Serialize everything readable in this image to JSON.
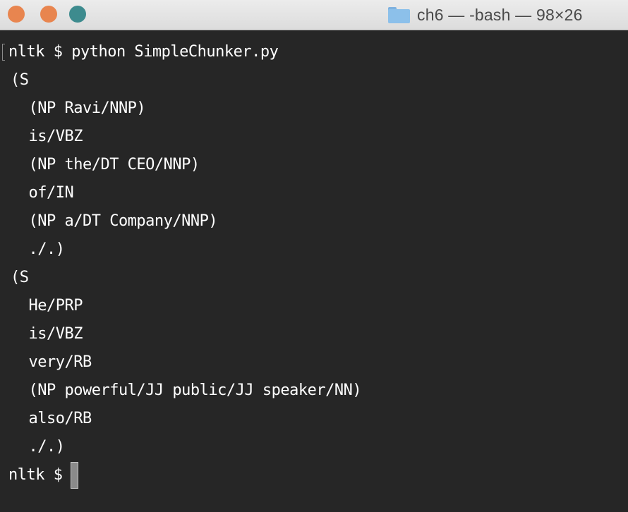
{
  "window": {
    "title": "ch6 — -bash — 98×26",
    "folder_icon": "folder-icon"
  },
  "terminal": {
    "lines": [
      "nltk $ python SimpleChunker.py",
      "(S",
      "  (NP Ravi/NNP)",
      "  is/VBZ",
      "  (NP the/DT CEO/NNP)",
      "  of/IN",
      "  (NP a/DT Company/NNP)",
      "  ./.)",
      "(S",
      "  He/PRP",
      "  is/VBZ",
      "  very/RB",
      "  (NP powerful/JJ public/JJ speaker/NN)",
      "  also/RB",
      "  ./.)"
    ],
    "prompt": "nltk $"
  },
  "colors": {
    "background": "#262626",
    "text": "#ffffff",
    "traffic_light_close": "#e8854f",
    "traffic_light_minimize": "#e8854f",
    "traffic_light_zoom": "#3d8b8e"
  }
}
